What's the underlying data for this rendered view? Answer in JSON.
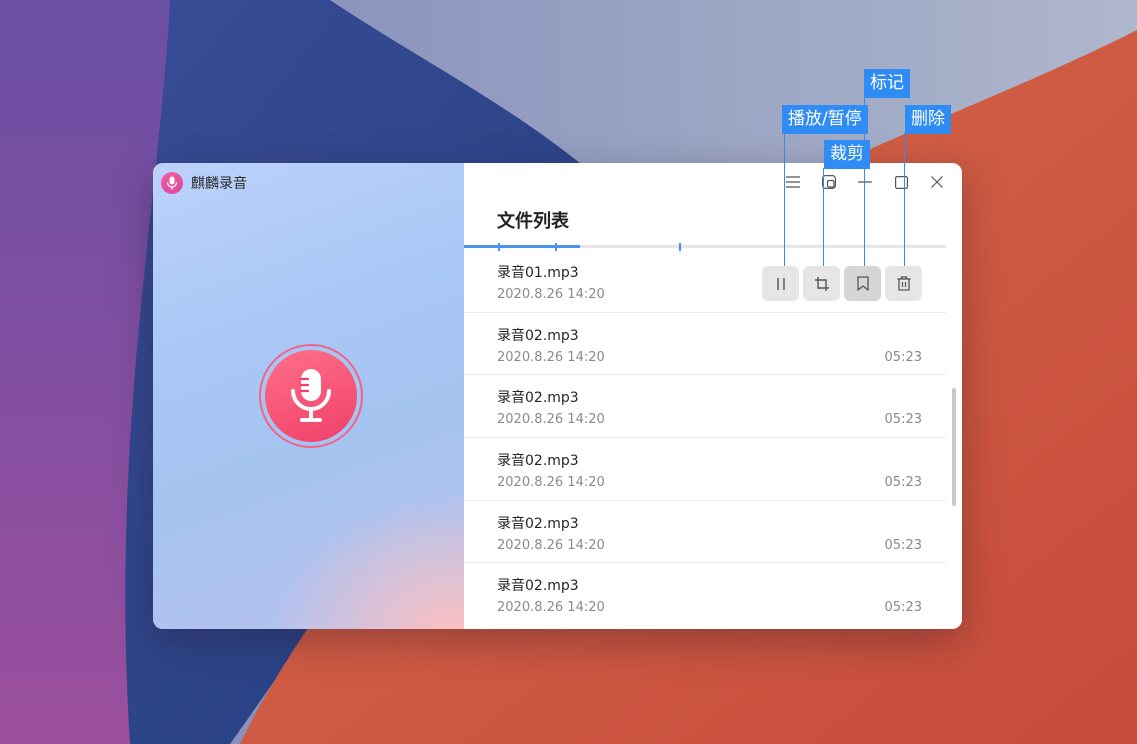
{
  "app": {
    "name": "麒麟录音"
  },
  "window_controls": [
    {
      "name": "menu-button",
      "icon": "hamburger-icon"
    },
    {
      "name": "mini-mode-button",
      "icon": "mini-window-icon"
    },
    {
      "name": "minimize-button",
      "icon": "minimize-icon"
    },
    {
      "name": "maximize-button",
      "icon": "maximize-icon"
    },
    {
      "name": "close-button",
      "icon": "close-icon"
    }
  ],
  "record": {
    "icon": "microphone-icon",
    "accent": "#f0406a"
  },
  "list": {
    "title": "文件列表",
    "items": [
      {
        "name": "录音01.mp3",
        "date": "2020.8.26  14:20",
        "duration": ""
      },
      {
        "name": "录音02.mp3",
        "date": "2020.8.26  14:20",
        "duration": "05:23"
      },
      {
        "name": "录音02.mp3",
        "date": "2020.8.26  14:20",
        "duration": "05:23"
      },
      {
        "name": "录音02.mp3",
        "date": "2020.8.26  14:20",
        "duration": "05:23"
      },
      {
        "name": "录音02.mp3",
        "date": "2020.8.26  14:20",
        "duration": "05:23"
      },
      {
        "name": "录音02.mp3",
        "date": "2020.8.26  14:20",
        "duration": "05:23"
      }
    ]
  },
  "item_actions": [
    {
      "name": "pause-button",
      "icon": "pause-icon"
    },
    {
      "name": "crop-button",
      "icon": "crop-icon"
    },
    {
      "name": "bookmark-button",
      "icon": "bookmark-icon"
    },
    {
      "name": "delete-button",
      "icon": "trash-icon"
    }
  ],
  "callouts": {
    "mark": "标记",
    "play_pause": "播放/暂停",
    "delete": "删除",
    "crop": "裁剪"
  },
  "colors": {
    "callout": "#2f8cf5",
    "wallpaper_red": "#c9563f",
    "wallpaper_blue": "#2f5291"
  }
}
